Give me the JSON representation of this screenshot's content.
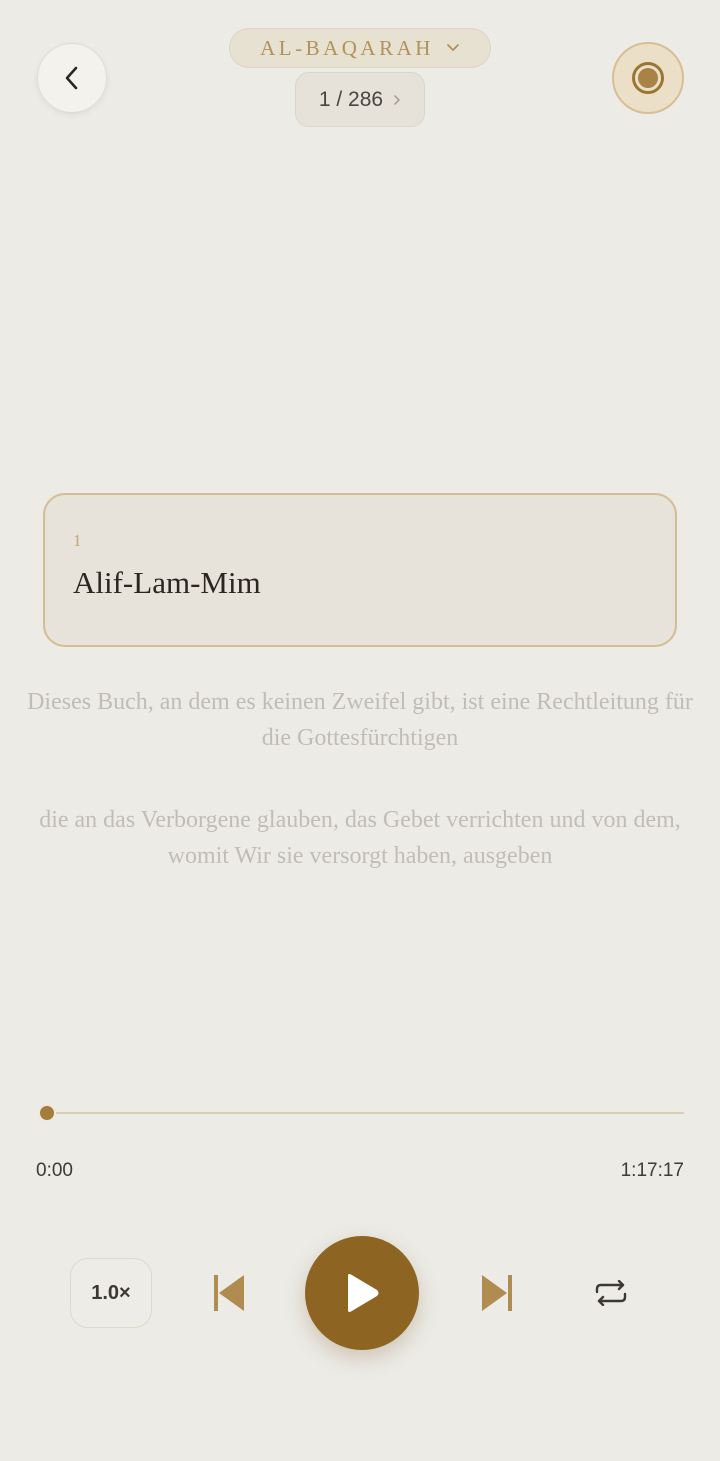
{
  "header": {
    "surah_name": "AL-BAQARAH",
    "ayah_counter": "1 / 286"
  },
  "current_verse": {
    "number": "1",
    "text": "Alif-Lam-Mim"
  },
  "following_verses": [
    {
      "text": "Dieses Buch, an dem es keinen Zweifel gibt, ist eine Rechtleitung für die Gottesfürchtigen"
    },
    {
      "text": "die an das Verborgene glauben, das Gebet verrichten und von dem, womit Wir sie versorgt haben, ausgeben"
    }
  ],
  "player": {
    "progress_fraction": 0.0,
    "time_current": "0:00",
    "time_total": "1:17:17",
    "speed_label": "1.0×"
  },
  "icons": {
    "back": "chevron-left-icon",
    "surah_dropdown": "chevron-down-icon",
    "ayah_next": "chevron-right-icon",
    "record": "record-icon",
    "previous": "skip-previous-icon",
    "play": "play-icon",
    "next": "skip-next-icon",
    "repeat": "repeat-icon"
  },
  "colors": {
    "background": "#ecebe6",
    "accent": "#8e6422",
    "accent_light": "#b2925a",
    "card_border": "#d4bd92"
  }
}
